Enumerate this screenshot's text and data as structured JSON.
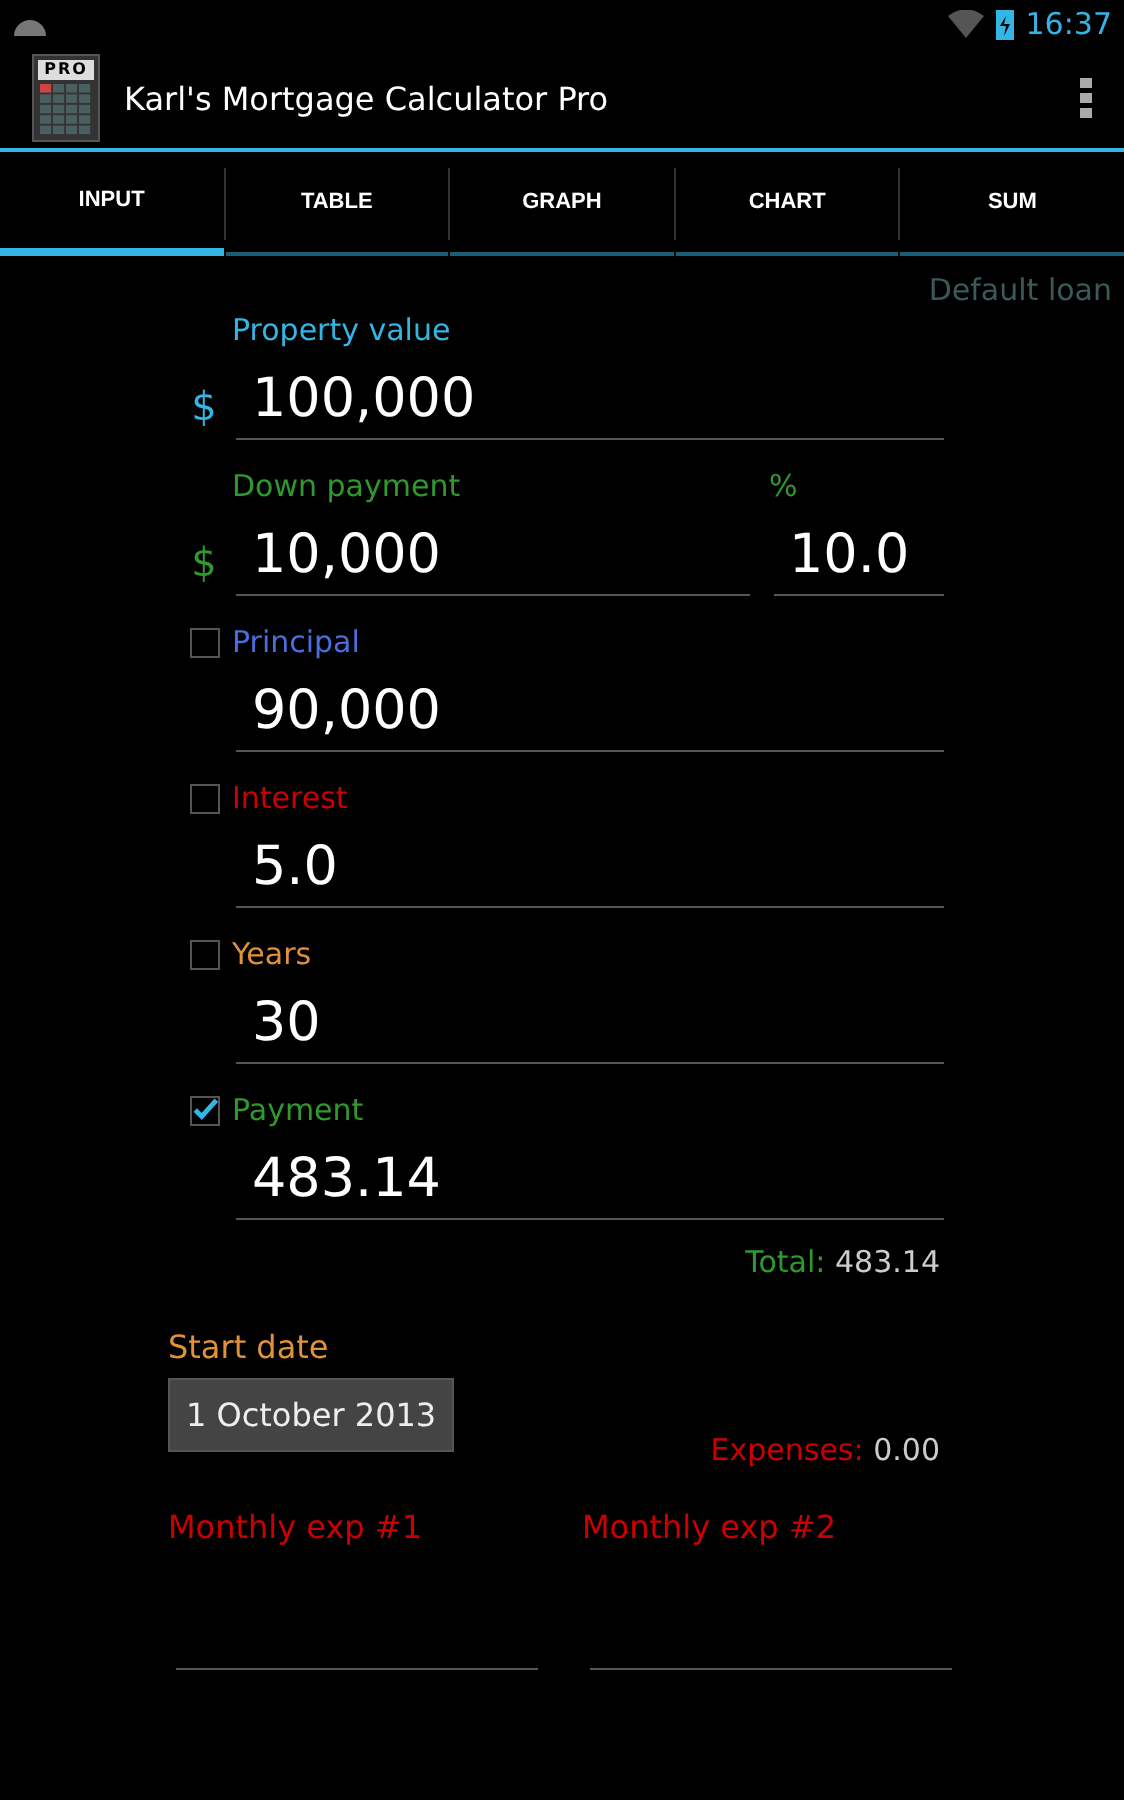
{
  "status_bar": {
    "time": "16:37"
  },
  "action_bar": {
    "title": "Karl's Mortgage Calculator Pro",
    "logo_text": "PRO"
  },
  "tabs": [
    {
      "label": "INPUT",
      "selected": true
    },
    {
      "label": "TABLE",
      "selected": false
    },
    {
      "label": "GRAPH",
      "selected": false
    },
    {
      "label": "CHART",
      "selected": false
    },
    {
      "label": "SUM",
      "selected": false
    }
  ],
  "loan_name": "Default loan",
  "fields": [
    {
      "kind": "currency",
      "label": "Property value",
      "color": "#33b5e5",
      "prefix": "$",
      "value": "100,000"
    },
    {
      "kind": "split",
      "label": "Down payment",
      "color": "#2e9a2e",
      "prefix": "$",
      "value": "10,000",
      "second_label": "%",
      "second_value": "10.0"
    },
    {
      "kind": "check",
      "label": "Principal",
      "color": "#4a6ee0",
      "checked": false,
      "value": "90,000"
    },
    {
      "kind": "check",
      "label": "Interest",
      "color": "#cc0000",
      "checked": false,
      "value": "5.0"
    },
    {
      "kind": "check",
      "label": "Years",
      "color": "#e0913a",
      "checked": false,
      "value": "30"
    },
    {
      "kind": "check",
      "label": "Payment",
      "color": "#2e9a2e",
      "checked": true,
      "value": "483.14"
    }
  ],
  "total": {
    "label": "Total:",
    "value": "483.14"
  },
  "start_date": {
    "label": "Start date",
    "value": "1 October 2013"
  },
  "expenses": {
    "label": "Expenses:",
    "value": "0.00"
  },
  "monthly_expenses": [
    {
      "label": "Monthly exp #1"
    },
    {
      "label": "Monthly exp #2"
    }
  ]
}
